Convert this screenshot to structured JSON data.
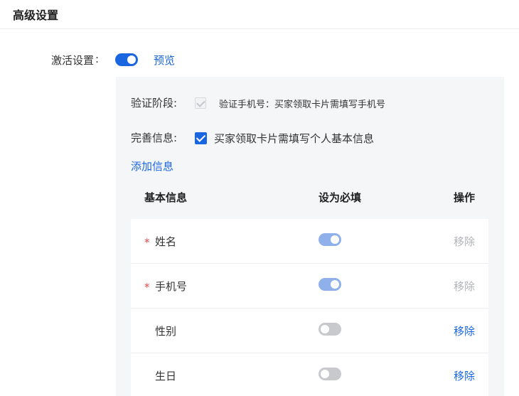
{
  "section": {
    "title": "高级设置"
  },
  "activate": {
    "label": "激活设置",
    "colon": ":",
    "enabled": true,
    "preview_label": "预览"
  },
  "verify": {
    "label": "验证阶段:",
    "checked": true,
    "disabled": true,
    "text": "验证手机号：买家领取卡片需填写手机号"
  },
  "complete_info": {
    "label": "完善信息:",
    "checked": true,
    "text": "买家领取卡片需填写个人基本信息"
  },
  "add_info_label": "添加信息",
  "table": {
    "headers": {
      "name": "基本信息",
      "required": "设为必填",
      "action": "操作"
    },
    "rows": [
      {
        "required_mark": "*",
        "name": "姓名",
        "required": true,
        "toggle_disabled": true,
        "action": "移除",
        "action_disabled": true
      },
      {
        "required_mark": "*",
        "name": "手机号",
        "required": true,
        "toggle_disabled": true,
        "action": "移除",
        "action_disabled": true
      },
      {
        "required_mark": "",
        "name": "性别",
        "required": false,
        "toggle_disabled": false,
        "action": "移除",
        "action_disabled": false
      },
      {
        "required_mark": "",
        "name": "生日",
        "required": false,
        "toggle_disabled": false,
        "action": "移除",
        "action_disabled": false
      }
    ]
  },
  "colors": {
    "primary": "#1a66e0",
    "required_mark": "#e84848",
    "panel_bg": "#f5f6f8",
    "toggle_disabled_on": "#8fb0ea",
    "toggle_off": "#c7c9cd"
  }
}
